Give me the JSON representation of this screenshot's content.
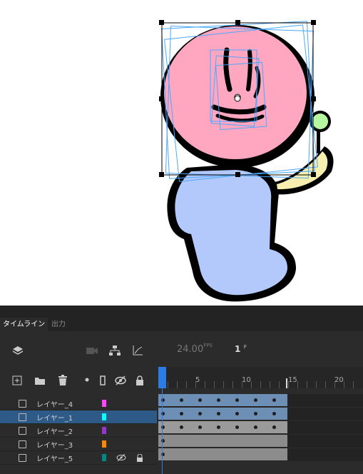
{
  "tabs": [
    {
      "label": "タイムライン"
    },
    {
      "label": "出力"
    }
  ],
  "fps_value": "24.00",
  "fps_unit": "FPS",
  "current_frame": "1",
  "frame_unit": "F",
  "ruler": {
    "labels": [
      "5",
      "10",
      "15",
      "20"
    ]
  },
  "layers": [
    {
      "name": "レイヤー_4",
      "color": "#ff44ff",
      "selected": false
    },
    {
      "name": "レイヤー_1",
      "color": "#00ffff",
      "selected": true
    },
    {
      "name": "レイヤー_2",
      "color": "#9933cc",
      "selected": false
    },
    {
      "name": "レイヤー_3",
      "color": "#ff8800",
      "selected": false
    },
    {
      "name": "レイヤー_5",
      "color": "#008888",
      "selected": false,
      "hidden": true,
      "locked": true
    }
  ],
  "colors": {
    "accent": "#2d7be5",
    "selected_row": "#2e5a87",
    "span_blue": "#6d8fb5",
    "span_gray": "#8c8c8c",
    "span_dark": "#9a9a9a"
  }
}
